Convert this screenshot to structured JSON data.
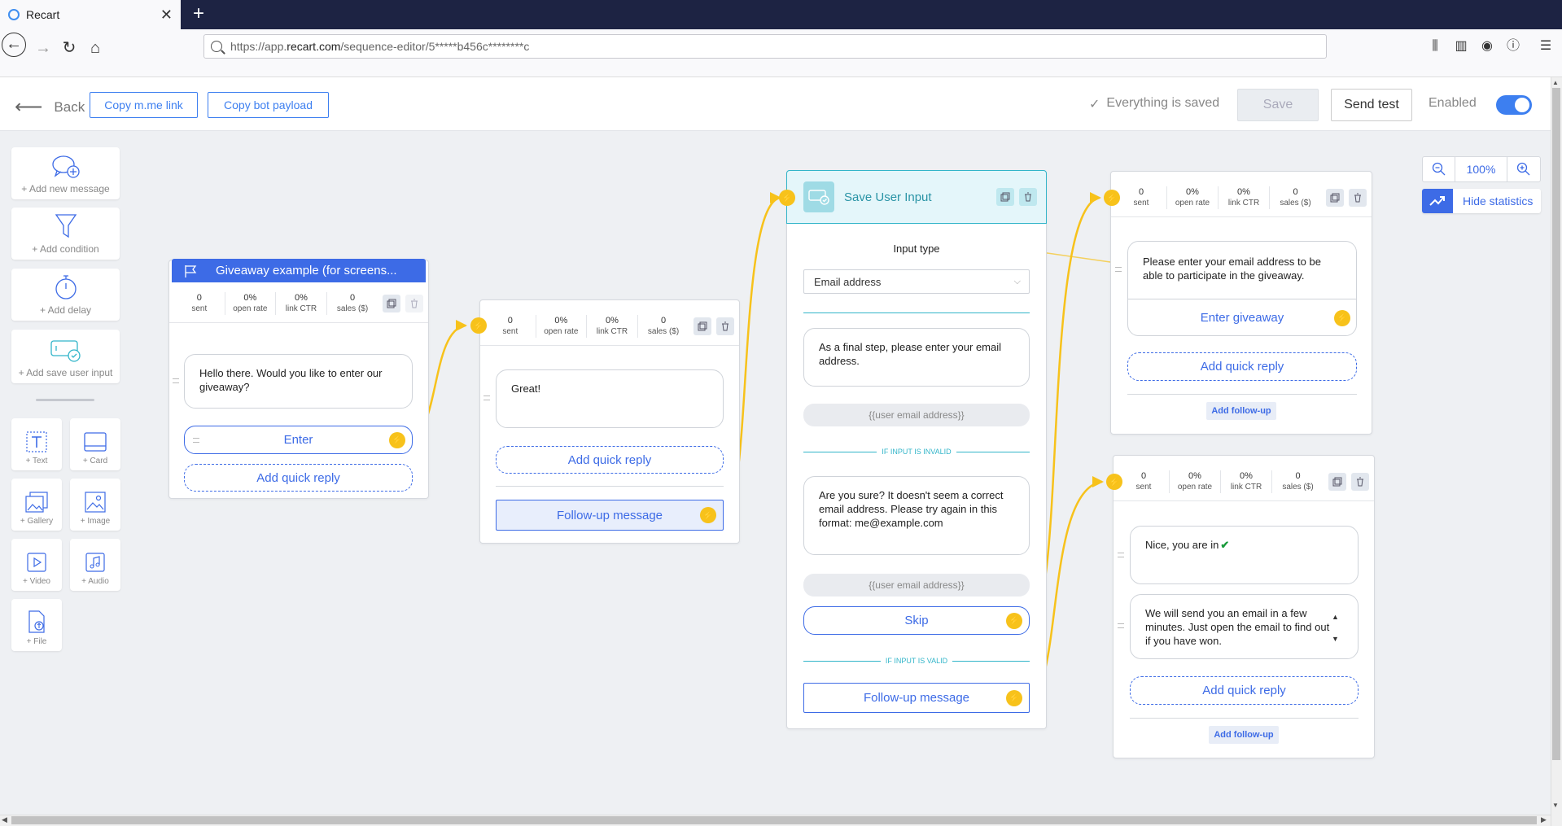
{
  "browser": {
    "tab_title": "Recart",
    "url_prefix": "https://app.",
    "url_domain": "recart.com",
    "url_path": "/sequence-editor/5*****b456c********c"
  },
  "header": {
    "back": "Back",
    "copy_link": "Copy m.me link",
    "copy_payload": "Copy bot payload",
    "saved_status": "Everything is saved",
    "save": "Save",
    "send_test": "Send test",
    "enabled": "Enabled"
  },
  "palette": {
    "add_message": "+ Add new message",
    "add_condition": "+ Add condition",
    "add_delay": "+ Add delay",
    "add_save_input": "+ Add save user input",
    "text": "+ Text",
    "card": "+ Card",
    "gallery": "+ Gallery",
    "image": "+ Image",
    "video": "+ Video",
    "audio": "+ Audio",
    "file": "+ File"
  },
  "stat_labels": {
    "sent": "sent",
    "open": "open rate",
    "ctr": "link CTR",
    "sales": "sales ($)"
  },
  "card1": {
    "title": "Giveaway example (for screens...",
    "sent": "0",
    "open": "0%",
    "ctr": "0%",
    "sales": "0",
    "message": "Hello there. Would you like to enter our giveaway?",
    "button": "Enter",
    "add_quick_reply": "Add quick reply"
  },
  "card2": {
    "sent": "0",
    "open": "0%",
    "ctr": "0%",
    "sales": "0",
    "message": "Great!",
    "add_quick_reply": "Add quick reply",
    "followup": "Follow-up message"
  },
  "card3": {
    "title": "Save User Input",
    "input_type_label": "Input type",
    "input_type_value": "Email address",
    "message": "As a final step, please enter your email address.",
    "variable": "{{user email address}}",
    "if_invalid": "IF INPUT IS INVALID",
    "invalid_message": "Are you sure? It doesn't seem a correct email address. Please try again in this format: me@example.com",
    "variable2": "{{user email address}}",
    "skip": "Skip",
    "if_valid": "IF INPUT IS VALID",
    "followup": "Follow-up message"
  },
  "card4": {
    "sent": "0",
    "open": "0%",
    "ctr": "0%",
    "sales": "0",
    "message": "Please enter your email address to be able to participate in the giveaway.",
    "button": "Enter giveaway",
    "add_quick_reply": "Add quick reply",
    "add_followup": "Add follow-up"
  },
  "card5": {
    "sent": "0",
    "open": "0%",
    "ctr": "0%",
    "sales": "0",
    "message1": "Nice, you are in",
    "message2": "We will send you an email in a few minutes. Just open the email to find out if you have won.",
    "add_quick_reply": "Add quick reply",
    "add_followup": "Add follow-up"
  },
  "zoom": {
    "level": "100%",
    "hide_stats": "Hide statistics"
  },
  "colors": {
    "accent": "#3d6be6",
    "connector": "#f7c21b",
    "save_input": "#32b5c9"
  }
}
